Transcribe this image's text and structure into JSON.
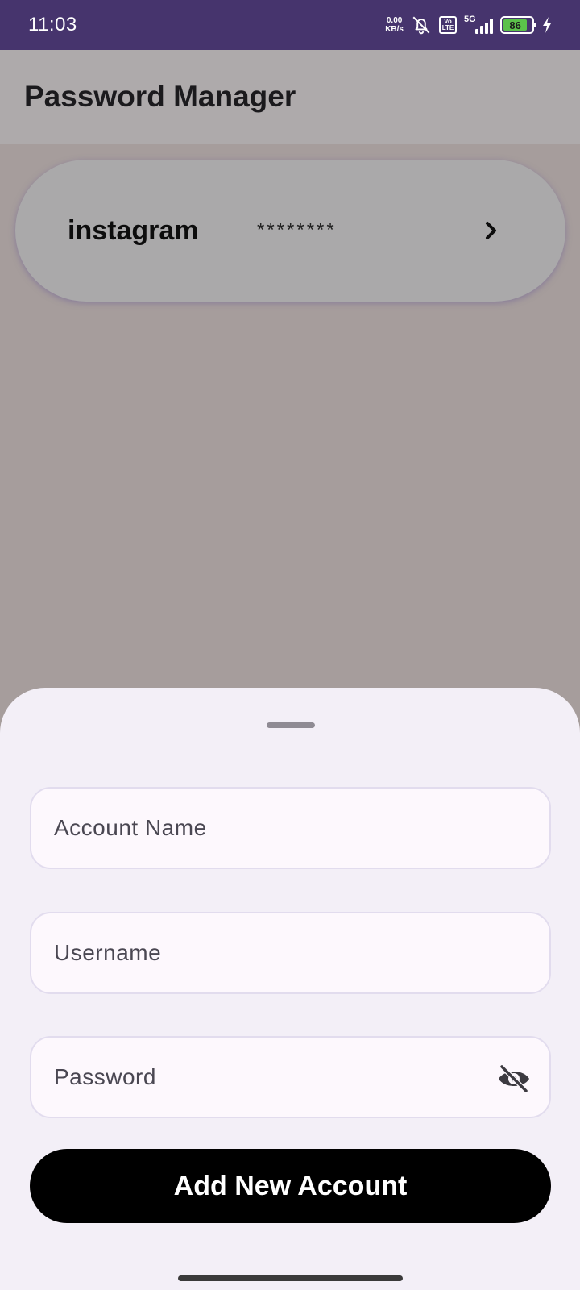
{
  "status_bar": {
    "time": "11:03",
    "net_speed_value": "0.00",
    "net_speed_unit": "KB/s",
    "volte_top": "Vo",
    "volte_bottom": "LTE",
    "network_type": "5G",
    "battery_level": "86",
    "icons": [
      "mute-bell-icon",
      "volte-icon",
      "signal-icon",
      "battery-icon",
      "charging-bolt-icon"
    ],
    "background_color": "#46346d",
    "battery_color": "#5bc24a"
  },
  "app_bar": {
    "title": "Password Manager"
  },
  "accounts": [
    {
      "name": "instagram",
      "password_masked": "********",
      "icon": "chevron-right-icon"
    }
  ],
  "bottom_sheet": {
    "account_name_placeholder": "Account Name",
    "username_placeholder": "Username",
    "password_placeholder": "Password",
    "password_toggle_icon": "eye-off-icon",
    "submit_label": "Add New Account",
    "submit_color": "#000000"
  }
}
